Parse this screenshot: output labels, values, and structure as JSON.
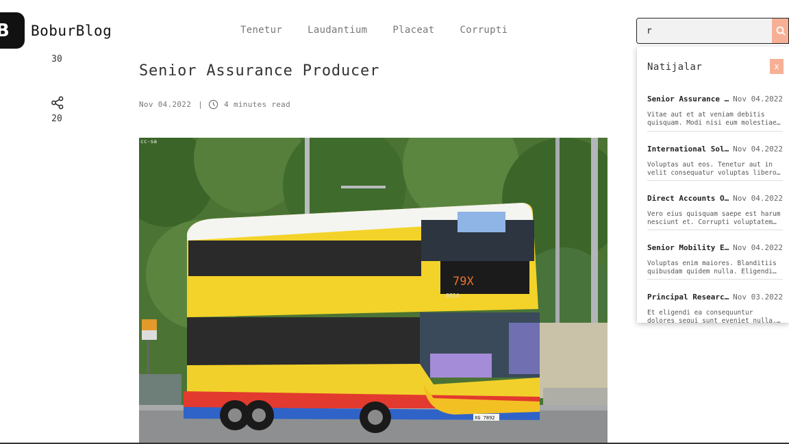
{
  "brand": {
    "logo_letter": "B",
    "name": "BoburBlog"
  },
  "nav": [
    "Tenetur",
    "Laudantium",
    "Placeat",
    "Corrupti"
  ],
  "search": {
    "value": "r",
    "icon": "search-icon"
  },
  "sidebar": {
    "likes": "30",
    "shares": "20",
    "share_icon": "share-icon"
  },
  "article": {
    "title": "Senior Assurance Producer",
    "date": "Nov 04.2022",
    "separator": "|",
    "read_time": "4 minutes read",
    "image_caption": "cc-sa",
    "bus_route_number": "79X",
    "bus_fleet_number": "8824",
    "bus_plate": "XG 7892"
  },
  "results": {
    "heading": "Natijalar",
    "close_label": "x",
    "items": [
      {
        "title": "Senior Assurance Producer",
        "date": "Nov 04.2022",
        "desc": "Vitae aut et at veniam debitis quisquam. Modi nisi eum molestiae sint."
      },
      {
        "title": "International Solutions",
        "date": "Nov 04.2022",
        "desc": "Voluptas aut eos. Tenetur aut in velit consequatur voluptas libero et."
      },
      {
        "title": "Direct Accounts Officer",
        "date": "Nov 04.2022",
        "desc": "Vero eius quisquam saepe est harum nesciunt et. Corrupti voluptatem qui."
      },
      {
        "title": "Senior Mobility Engineer",
        "date": "Nov 04.2022",
        "desc": "Voluptas enim maiores. Blanditiis quibusdam quidem nulla. Eligendi est."
      },
      {
        "title": "Principal Research Analyst",
        "date": "Nov 03.2022",
        "desc": "Et eligendi ea consequuntur dolores sequi sunt eveniet nulla. Quasi qu."
      }
    ]
  },
  "colors": {
    "accent": "#f7b096",
    "text": "#222222",
    "muted": "#777777"
  }
}
